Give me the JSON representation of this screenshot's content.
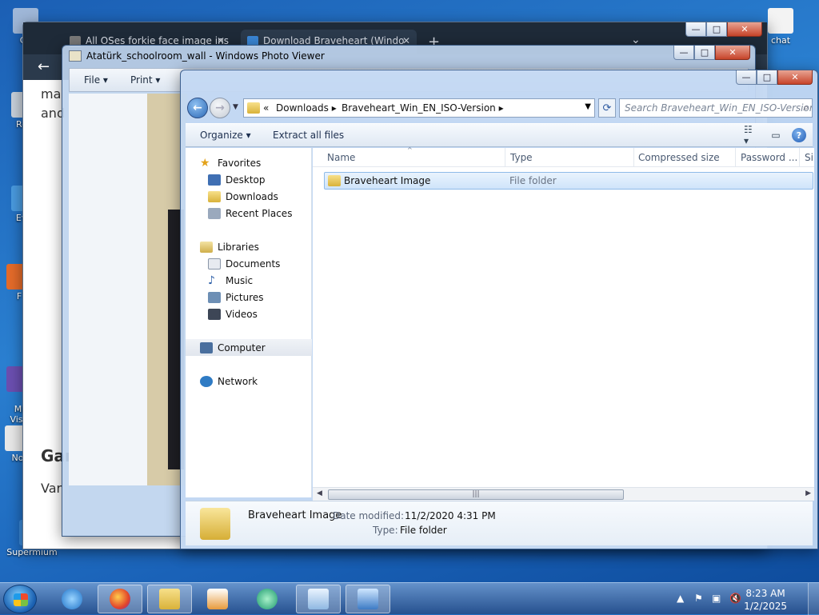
{
  "desktop": {
    "icons": [
      {
        "label": "Co",
        "color": "#9fb7d8"
      },
      {
        "label": "Rec",
        "color": "#c9d2dc"
      },
      {
        "label": "Eve",
        "color": "#4a9be0"
      },
      {
        "label": "F",
        "color": "#e46b2a"
      },
      {
        "label": "Mi\nVisu",
        "color": "#6b4fb0"
      },
      {
        "label": "No",
        "color": "#e8e8e8"
      },
      {
        "label": "Supermium",
        "color": "#3c8ad8"
      },
      {
        "label": "chat",
        "color": "#f3f3f3"
      }
    ]
  },
  "browser": {
    "tab1": "All OSes forkie face image ins",
    "tab2": "Download Braveheart (Windo",
    "new_tab": "+",
    "text_fragments": [
      "ma",
      "and",
      "Var"
    ],
    "heading_fragment": "Gar"
  },
  "photo_viewer": {
    "title": "Atatürk_schoolroom_wall - Windows Photo Viewer",
    "menu": {
      "file": "File",
      "print": "Print"
    }
  },
  "explorer": {
    "breadcrumbs": {
      "root": "«",
      "c1": "Downloads",
      "c2": "Braveheart_Win_EN_ISO-Version"
    },
    "search_placeholder": "Search Braveheart_Win_EN_ISO-Version",
    "commands": {
      "organize": "Organize",
      "extract": "Extract all files"
    },
    "nav": {
      "favorites": "Favorites",
      "desktop": "Desktop",
      "downloads": "Downloads",
      "recent": "Recent Places",
      "libraries": "Libraries",
      "documents": "Documents",
      "music": "Music",
      "pictures": "Pictures",
      "videos": "Videos",
      "computer": "Computer",
      "network": "Network"
    },
    "columns": {
      "name": "Name",
      "type": "Type",
      "compressed": "Compressed size",
      "password": "Password ...",
      "extra": "Si"
    },
    "rows": [
      {
        "name": "Braveheart Image",
        "type": "File folder"
      }
    ],
    "details": {
      "name": "Braveheart Image",
      "modified_label": "Date modified:",
      "modified_value": "11/2/2020 4:31 PM",
      "type_label": "Type:",
      "type_value": "File folder"
    }
  },
  "taskbar": {
    "time": "8:23 AM",
    "date": "1/2/2025"
  }
}
